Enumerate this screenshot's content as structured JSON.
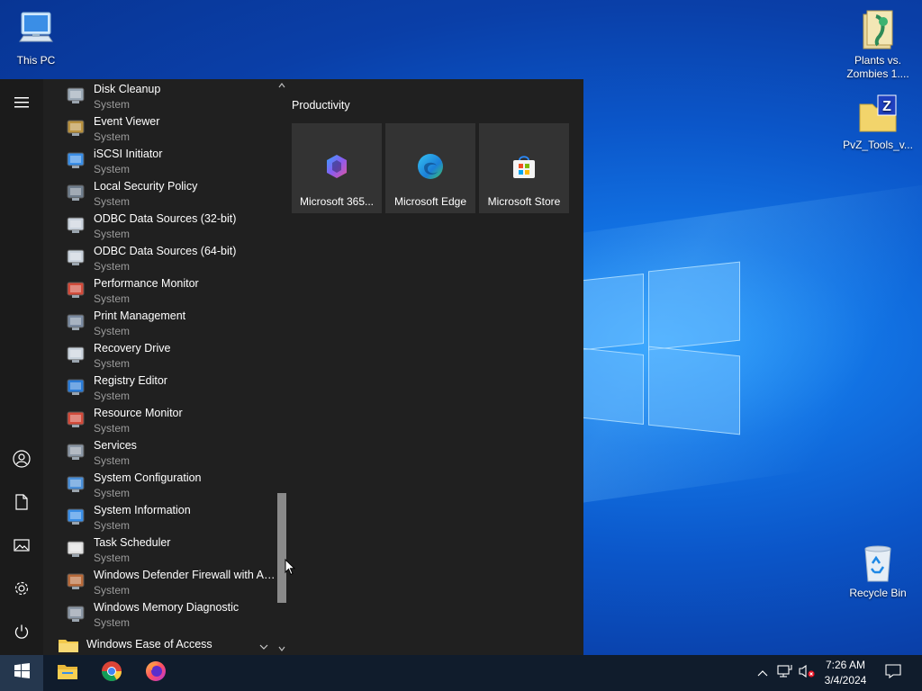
{
  "desktop": {
    "icons": [
      {
        "label": "This PC",
        "icon": "this-pc-icon"
      },
      {
        "label": "Plants vs. Zombies 1....",
        "icon": "pvz-folder-icon"
      },
      {
        "label": "PvZ_Tools_v...",
        "icon": "zip-archive-icon"
      },
      {
        "label": "Recycle Bin",
        "icon": "recycle-bin-icon"
      }
    ]
  },
  "start_menu": {
    "apps": [
      {
        "name": "Disk Cleanup",
        "sub": "System",
        "icon": "disk-cleanup-icon"
      },
      {
        "name": "Event Viewer",
        "sub": "System",
        "icon": "event-viewer-icon"
      },
      {
        "name": "iSCSI Initiator",
        "sub": "System",
        "icon": "iscsi-initiator-icon"
      },
      {
        "name": "Local Security Policy",
        "sub": "System",
        "icon": "local-security-policy-icon"
      },
      {
        "name": "ODBC Data Sources (32-bit)",
        "sub": "System",
        "icon": "odbc-32-icon"
      },
      {
        "name": "ODBC Data Sources (64-bit)",
        "sub": "System",
        "icon": "odbc-64-icon"
      },
      {
        "name": "Performance Monitor",
        "sub": "System",
        "icon": "performance-monitor-icon"
      },
      {
        "name": "Print Management",
        "sub": "System",
        "icon": "print-management-icon"
      },
      {
        "name": "Recovery Drive",
        "sub": "System",
        "icon": "recovery-drive-icon"
      },
      {
        "name": "Registry Editor",
        "sub": "System",
        "icon": "registry-editor-icon"
      },
      {
        "name": "Resource Monitor",
        "sub": "System",
        "icon": "resource-monitor-icon"
      },
      {
        "name": "Services",
        "sub": "System",
        "icon": "services-icon"
      },
      {
        "name": "System Configuration",
        "sub": "System",
        "icon": "system-configuration-icon"
      },
      {
        "name": "System Information",
        "sub": "System",
        "icon": "system-information-icon"
      },
      {
        "name": "Task Scheduler",
        "sub": "System",
        "icon": "task-scheduler-icon"
      },
      {
        "name": "Windows Defender Firewall with Ad...",
        "sub": "System",
        "icon": "firewall-icon"
      },
      {
        "name": "Windows Memory Diagnostic",
        "sub": "System",
        "icon": "memory-diagnostic-icon"
      }
    ],
    "folder": {
      "name": "Windows Ease of Access",
      "icon": "folder-icon"
    },
    "group_title": "Productivity",
    "tiles": [
      {
        "label": "Microsoft 365...",
        "icon": "microsoft-365-icon"
      },
      {
        "label": "Microsoft Edge",
        "icon": "edge-icon"
      },
      {
        "label": "Microsoft Store",
        "icon": "store-icon"
      }
    ]
  },
  "taskbar": {
    "time": "7:26 AM",
    "date": "3/4/2024",
    "pinned": [
      "File Explorer",
      "Google Chrome",
      "Firefox"
    ]
  }
}
